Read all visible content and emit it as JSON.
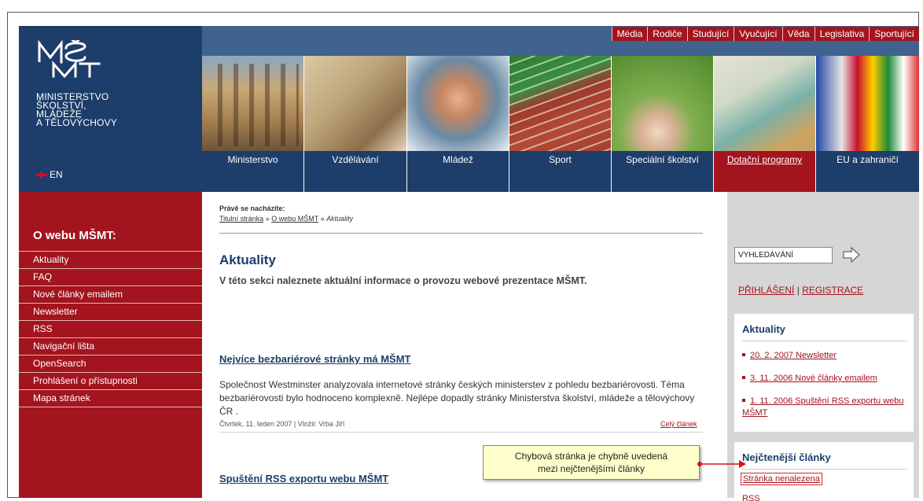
{
  "brand": {
    "name_lines": [
      "MINISTERSTVO",
      "ŠKOLSTVÍ,",
      "MLÁDEŽE",
      "A TĚLOVÝCHOVY"
    ],
    "logo_icon": "msmt-logo-icon",
    "lang_label": "EN",
    "lang_icon": "uk-flag-icon"
  },
  "toplinks": [
    "Média",
    "Rodiče",
    "Studující",
    "Vyučující",
    "Věda",
    "Legislativa",
    "Sportující"
  ],
  "mainnav": [
    {
      "label": "Ministerstvo",
      "active": false
    },
    {
      "label": "Vzdělávání",
      "active": false
    },
    {
      "label": "Mládež",
      "active": false
    },
    {
      "label": "Sport",
      "active": false
    },
    {
      "label": "Speciální školství",
      "active": false
    },
    {
      "label": "Dotační programy",
      "active": true
    },
    {
      "label": "EU a zahraničí",
      "active": false
    }
  ],
  "leftmenu": {
    "title": "O webu MŠMT:",
    "items": [
      "Aktuality",
      "FAQ",
      "Nové články emailem",
      "Newsletter",
      "RSS",
      "Navigační lišta",
      "OpenSearch",
      "Prohlášení o přístupnosti",
      "Mapa stránek"
    ]
  },
  "content": {
    "you_are_here": "Právě se nacházíte:",
    "breadcrumb": {
      "home": "Titulní stránka",
      "sep": " » ",
      "parent": "O webu MŠMT",
      "current": "Aktuality"
    },
    "title": "Aktuality",
    "intro": "V této sekci naleznete aktuální informace o provozu webové prezentace MŠMT.",
    "article1": {
      "title": "Nejvíce bezbariérové stránky má MŠMT",
      "body": "Společnost Westminster analyzovala internetové stránky českých ministerstev z pohledu bezbariérovosti. Téma bezbariérovosti bylo hodnoceno komplexně. Nejlépe dopadly stránky Ministerstva školství, mládeže a tělovýchovy ČR .",
      "meta": "Čtvrtek, 11. leden 2007 | Vložil: Vrba Jiří",
      "more": "Celý článek"
    },
    "article2": {
      "title": "Spuštění RSS exportu webu MŠMT"
    }
  },
  "right": {
    "search_value": "VYHLEDÁVÁNÍ",
    "search_go_icon": "arrow-right-icon",
    "login": "PŘIHLÁŠENÍ",
    "auth_sep": " | ",
    "register": "REGISTRACE",
    "news_title": "Aktuality",
    "news": [
      "20. 2. 2007 Newsletter",
      "3. 11. 2006 Nové články emailem",
      "1. 11. 2006 Spuštění RSS exportu webu MŠMT"
    ],
    "most_read_title": "Nejčtenější články",
    "most_read": [
      "Stránka nenalezena",
      "RSS"
    ]
  },
  "callout": {
    "line1": "Chybová stránka je chybně uvedená",
    "line2": "mezi nejčtenějšími články"
  },
  "colors": {
    "navy": "#1d3d6a",
    "crimson": "#a3141e",
    "sidebar_gray": "#d6d6d6",
    "callout_bg": "#ffffcc"
  }
}
